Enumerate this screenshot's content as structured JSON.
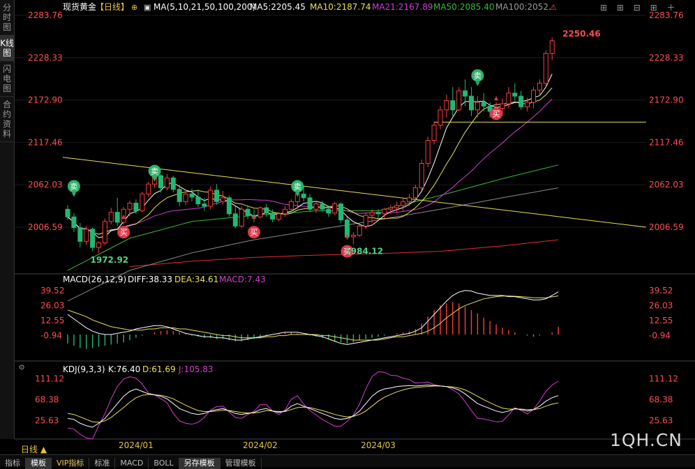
{
  "sidebar": {
    "tabs": [
      {
        "label": "分时图",
        "active": false
      },
      {
        "label": "K线图",
        "active": true
      },
      {
        "label": "闪电图",
        "active": false
      },
      {
        "label": "合约资料",
        "active": false
      }
    ]
  },
  "header": {
    "title": "现货黄金",
    "period_tag": "【日线】",
    "ma_label": "MA(5,10,21,50,100,200)",
    "ma5": "MA5:2205.45",
    "ma10": "MA10:2187.74",
    "ma21": "MA21:2167.89",
    "ma50": "MA50:2085.40",
    "ma100": "MA100:2052."
  },
  "macd_header": {
    "label": "MACD(26,12,9)",
    "diff": "DIFF:38.33",
    "dea": "DEA:34.61",
    "macd": "MACD:7.43"
  },
  "kdj_header": {
    "label": "KDJ(9,3,3)",
    "k": "K:76.40",
    "d": "D:61.69",
    "j": "J:105.83"
  },
  "period_label": "日线",
  "watermark": "1QH.CN",
  "bottom_tabs": [
    "指标",
    "模板",
    "VIP指标",
    "标准",
    "MACD",
    "BOLL",
    "另存模板",
    "管理模板"
  ],
  "colors": {
    "up": "#ff3b3b",
    "down": "#22b873",
    "ma5": "#ffffff",
    "ma10": "#e8e05a",
    "ma21": "#d040d0",
    "ma50": "#38b838",
    "ma100": "#8a8a8a",
    "ma200": "#e03030",
    "diff": "#ffffff",
    "dea": "#e8e05a",
    "trendline": "#e8e05a",
    "axis_text": "#ff4d4d"
  },
  "chart_data": {
    "type": "candlestick",
    "price_axis": {
      "min": 1950,
      "max": 2283.76,
      "ticks": [
        2283.76,
        2228.33,
        2172.9,
        2117.46,
        2062.03,
        2006.59
      ]
    },
    "macd_axis": {
      "min": -20,
      "max": 45,
      "ticks": [
        39.52,
        26.03,
        12.55,
        -0.94
      ]
    },
    "kdj_axis": {
      "min": -5,
      "max": 120,
      "ticks": [
        111.12,
        68.38,
        25.63
      ]
    },
    "x_labels": [
      {
        "label": "2024/01",
        "index": 11
      },
      {
        "label": "2024/02",
        "index": 31
      },
      {
        "label": "2024/03",
        "index": 50
      }
    ],
    "ohlc": [
      [
        2030,
        2035,
        2016,
        2020
      ],
      [
        2020,
        2025,
        2000,
        2006
      ],
      [
        2006,
        2012,
        1980,
        1988
      ],
      [
        1988,
        2008,
        1983,
        2004
      ],
      [
        2004,
        2006,
        1975,
        1980
      ],
      [
        1980,
        1988,
        1972.92,
        1986
      ],
      [
        1986,
        2018,
        1983,
        2014
      ],
      [
        2014,
        2032,
        2010,
        2026
      ],
      [
        2026,
        2045,
        2008,
        2013
      ],
      [
        2013,
        2033,
        2010,
        2030
      ],
      [
        2030,
        2041,
        2021,
        2038
      ],
      [
        2038,
        2043,
        2024,
        2028
      ],
      [
        2028,
        2053,
        2026,
        2050
      ],
      [
        2050,
        2066,
        2046,
        2063
      ],
      [
        2063,
        2078,
        2058,
        2074
      ],
      [
        2074,
        2076,
        2052,
        2058
      ],
      [
        2058,
        2076,
        2055,
        2071
      ],
      [
        2071,
        2074,
        2052,
        2056
      ],
      [
        2056,
        2062,
        2034,
        2040
      ],
      [
        2040,
        2053,
        2036,
        2050
      ],
      [
        2050,
        2057,
        2040,
        2046
      ],
      [
        2046,
        2056,
        2033,
        2037
      ],
      [
        2037,
        2045,
        2028,
        2034
      ],
      [
        2034,
        2060,
        2030,
        2055
      ],
      [
        2055,
        2063,
        2036,
        2040
      ],
      [
        2040,
        2054,
        2036,
        2045
      ],
      [
        2045,
        2048,
        2020,
        2024
      ],
      [
        2024,
        2034,
        2005,
        2008
      ],
      [
        2008,
        2034,
        2006,
        2030
      ],
      [
        2030,
        2035,
        2017,
        2022
      ],
      [
        2022,
        2030,
        2013,
        2020
      ],
      [
        2020,
        2034,
        2018,
        2032
      ],
      [
        2032,
        2037,
        2020,
        2025
      ],
      [
        2025,
        2030,
        2013,
        2017
      ],
      [
        2017,
        2026,
        2014,
        2024
      ],
      [
        2024,
        2034,
        2020,
        2030
      ],
      [
        2030,
        2043,
        2027,
        2040
      ],
      [
        2040,
        2055,
        2032,
        2050
      ],
      [
        2050,
        2060,
        2040,
        2045
      ],
      [
        2045,
        2050,
        2026,
        2030
      ],
      [
        2030,
        2040,
        2025,
        2037
      ],
      [
        2037,
        2041,
        2027,
        2030
      ],
      [
        2030,
        2035,
        2020,
        2025
      ],
      [
        2025,
        2040,
        2022,
        2037
      ],
      [
        2037,
        2039,
        2012,
        2016
      ],
      [
        2016,
        2020,
        1990,
        1994
      ],
      [
        1994,
        2000,
        1984.12,
        1996
      ],
      [
        1996,
        2012,
        1994,
        2008
      ],
      [
        2008,
        2026,
        2004,
        2022
      ],
      [
        2022,
        2030,
        2012,
        2026
      ],
      [
        2026,
        2030,
        2018,
        2024
      ],
      [
        2024,
        2032,
        2018,
        2030
      ],
      [
        2030,
        2036,
        2024,
        2032
      ],
      [
        2032,
        2040,
        2026,
        2035
      ],
      [
        2035,
        2045,
        2028,
        2040
      ],
      [
        2040,
        2050,
        2034,
        2045
      ],
      [
        2045,
        2062,
        2040,
        2058
      ],
      [
        2058,
        2095,
        2055,
        2090
      ],
      [
        2090,
        2125,
        2085,
        2120
      ],
      [
        2120,
        2145,
        2115,
        2140
      ],
      [
        2140,
        2165,
        2135,
        2160
      ],
      [
        2160,
        2180,
        2150,
        2172
      ],
      [
        2172,
        2190,
        2152,
        2160
      ],
      [
        2160,
        2190,
        2158,
        2185
      ],
      [
        2185,
        2200,
        2165,
        2178
      ],
      [
        2178,
        2190,
        2152,
        2160
      ],
      [
        2160,
        2178,
        2150,
        2170
      ],
      [
        2170,
        2182,
        2158,
        2165
      ],
      [
        2165,
        2170,
        2150,
        2158
      ],
      [
        2158,
        2170,
        2148,
        2162
      ],
      [
        2162,
        2175,
        2152,
        2168
      ],
      [
        2168,
        2190,
        2162,
        2182
      ],
      [
        2182,
        2195,
        2172,
        2178
      ],
      [
        2178,
        2185,
        2160,
        2164
      ],
      [
        2164,
        2176,
        2158,
        2170
      ],
      [
        2170,
        2190,
        2162,
        2186
      ],
      [
        2186,
        2200,
        2178,
        2195
      ],
      [
        2195,
        2238,
        2190,
        2234
      ],
      [
        2234,
        2255,
        2225,
        2250.46
      ]
    ],
    "markers": [
      {
        "type": "sell",
        "label": "卖",
        "index": 1,
        "price": 2060
      },
      {
        "type": "sell",
        "label": "卖",
        "index": 14,
        "price": 2080
      },
      {
        "type": "sell",
        "label": "卖",
        "index": 37,
        "price": 2060
      },
      {
        "type": "sell",
        "label": "卖",
        "index": 66,
        "price": 2205
      },
      {
        "type": "buy",
        "label": "买",
        "index": 9,
        "price": 2000
      },
      {
        "type": "buy",
        "label": "买",
        "index": 30,
        "price": 2000
      },
      {
        "type": "buy",
        "label": "买",
        "index": 45,
        "price": 1975
      },
      {
        "type": "buy",
        "label": "买",
        "index": 69,
        "price": 2155
      }
    ],
    "annotations": [
      {
        "label": "2250.46",
        "index": 79,
        "price": 2250.46,
        "color": "#ff4d4d"
      },
      {
        "label": "1972.92",
        "index": 5,
        "price": 1972.92,
        "color": "#4fd48a"
      },
      {
        "label": "1984.12",
        "index": 46,
        "price": 1984.12,
        "color": "#4fd48a"
      }
    ],
    "trendlines": [
      {
        "from": [
          0,
          2098
        ],
        "to": [
          86,
          2006.59
        ],
        "color": "#e8e05a"
      },
      {
        "from": [
          59,
          2144
        ],
        "to": [
          86,
          2144
        ],
        "color": "#e8e05a"
      }
    ],
    "ma_lines": {
      "ma50": [
        [
          0,
          1950
        ],
        [
          10,
          1992
        ],
        [
          20,
          2014
        ],
        [
          30,
          2022
        ],
        [
          40,
          2028
        ],
        [
          50,
          2028
        ],
        [
          60,
          2048
        ],
        [
          70,
          2070
        ],
        [
          79,
          2088
        ]
      ],
      "ma100": [
        [
          0,
          1910
        ],
        [
          10,
          1950
        ],
        [
          20,
          1973
        ],
        [
          30,
          1990
        ],
        [
          40,
          2003
        ],
        [
          50,
          2016
        ],
        [
          60,
          2030
        ],
        [
          70,
          2045
        ],
        [
          79,
          2058
        ]
      ],
      "ma200": [
        [
          10,
          1955
        ],
        [
          20,
          1962
        ],
        [
          30,
          1967
        ],
        [
          40,
          1970
        ],
        [
          50,
          1972
        ],
        [
          60,
          1975
        ],
        [
          70,
          1982
        ],
        [
          79,
          1990
        ]
      ]
    },
    "macd_hist": [
      -8,
      -10,
      -12,
      -13,
      -12,
      -11,
      -10,
      -9,
      -8,
      -7,
      -5,
      -3,
      -1,
      0,
      2,
      3,
      4,
      3,
      2,
      1,
      -1,
      -2,
      -3,
      -3,
      -4,
      -4,
      -5,
      -6,
      -6,
      -5,
      -4,
      -3,
      -1,
      0,
      1,
      2,
      2,
      1,
      0,
      -1,
      -2,
      -3,
      -4,
      -6,
      -7,
      -8,
      -7,
      -5,
      -4,
      -3,
      -2,
      -1,
      0,
      1,
      2,
      3,
      5,
      10,
      16,
      22,
      26,
      28,
      29,
      28,
      25,
      22,
      19,
      15,
      12,
      9,
      6,
      4,
      2,
      0,
      -1,
      -2,
      -1,
      0,
      2,
      7
    ],
    "macd_diff": [
      18,
      14,
      10,
      6,
      3,
      1,
      0,
      0,
      1,
      2,
      3,
      5,
      6,
      7,
      8,
      8,
      7,
      5,
      3,
      1,
      0,
      -1,
      -2,
      -2,
      -3,
      -3,
      -4,
      -5,
      -5,
      -4,
      -3,
      -2,
      -1,
      0,
      1,
      2,
      2,
      2,
      1,
      0,
      -1,
      -2,
      -4,
      -6,
      -8,
      -9,
      -8,
      -7,
      -6,
      -5,
      -4,
      -3,
      -2,
      -1,
      0,
      1,
      3,
      6,
      12,
      18,
      24,
      30,
      35,
      38,
      39.5,
      39,
      37,
      36,
      35,
      35,
      35,
      34,
      34,
      33,
      32,
      31,
      31,
      32,
      35,
      38.33
    ],
    "macd_dea": [
      22,
      20,
      18,
      16,
      13,
      11,
      9,
      7,
      6,
      5,
      4,
      4,
      4,
      5,
      5,
      6,
      6,
      6,
      5,
      5,
      4,
      3,
      2,
      1,
      0,
      -1,
      -1,
      -2,
      -3,
      -3,
      -3,
      -3,
      -2,
      -2,
      -1,
      -1,
      0,
      0,
      0,
      0,
      0,
      -1,
      -1,
      -2,
      -3,
      -4,
      -5,
      -5,
      -5,
      -5,
      -5,
      -4,
      -3,
      -2,
      -2,
      -1,
      0,
      1,
      3,
      6,
      10,
      15,
      19,
      23,
      26,
      28,
      30,
      32,
      33,
      34,
      34.5,
      34.5,
      34.3,
      34,
      33.5,
      33,
      32.8,
      33,
      33.8,
      34.61
    ],
    "kdj_k": [
      30,
      28,
      20,
      15,
      12,
      20,
      30,
      45,
      60,
      75,
      85,
      90,
      85,
      80,
      78,
      75,
      70,
      60,
      50,
      45,
      40,
      38,
      40,
      45,
      48,
      50,
      45,
      40,
      38,
      40,
      42,
      48,
      50,
      45,
      42,
      45,
      55,
      60,
      55,
      50,
      45,
      40,
      35,
      30,
      28,
      30,
      35,
      45,
      60,
      75,
      85,
      90,
      92,
      95,
      96,
      97,
      96,
      97,
      98,
      97,
      96,
      95,
      92,
      88,
      80,
      70,
      60,
      55,
      50,
      45,
      42,
      45,
      50,
      48,
      45,
      48,
      55,
      65,
      72,
      76.4
    ],
    "kdj_d": [
      40,
      38,
      33,
      28,
      23,
      22,
      25,
      32,
      42,
      52,
      63,
      72,
      77,
      79,
      78,
      77,
      74,
      70,
      63,
      57,
      51,
      46,
      44,
      44,
      45,
      47,
      46,
      44,
      42,
      41,
      41,
      43,
      46,
      45,
      44,
      44,
      48,
      52,
      53,
      52,
      49,
      46,
      42,
      38,
      35,
      33,
      34,
      38,
      45,
      55,
      65,
      73,
      79,
      84,
      88,
      91,
      93,
      94,
      95,
      96,
      96,
      95,
      94,
      92,
      88,
      82,
      75,
      68,
      62,
      56,
      51,
      49,
      49,
      49,
      48,
      48,
      50,
      55,
      59,
      61.69
    ],
    "kdj_j": [
      10,
      8,
      -2,
      -10,
      -12,
      15,
      40,
      70,
      95,
      110,
      115,
      112,
      100,
      82,
      78,
      70,
      62,
      40,
      25,
      20,
      18,
      22,
      32,
      47,
      54,
      55,
      43,
      32,
      30,
      38,
      44,
      58,
      58,
      45,
      38,
      47,
      69,
      76,
      59,
      46,
      37,
      28,
      21,
      14,
      14,
      24,
      37,
      59,
      90,
      115,
      125,
      124,
      118,
      117,
      112,
      109,
      102,
      103,
      104,
      99,
      96,
      95,
      88,
      80,
      64,
      46,
      30,
      29,
      26,
      23,
      24,
      37,
      52,
      46,
      39,
      48,
      65,
      85,
      98,
      105.83
    ]
  }
}
